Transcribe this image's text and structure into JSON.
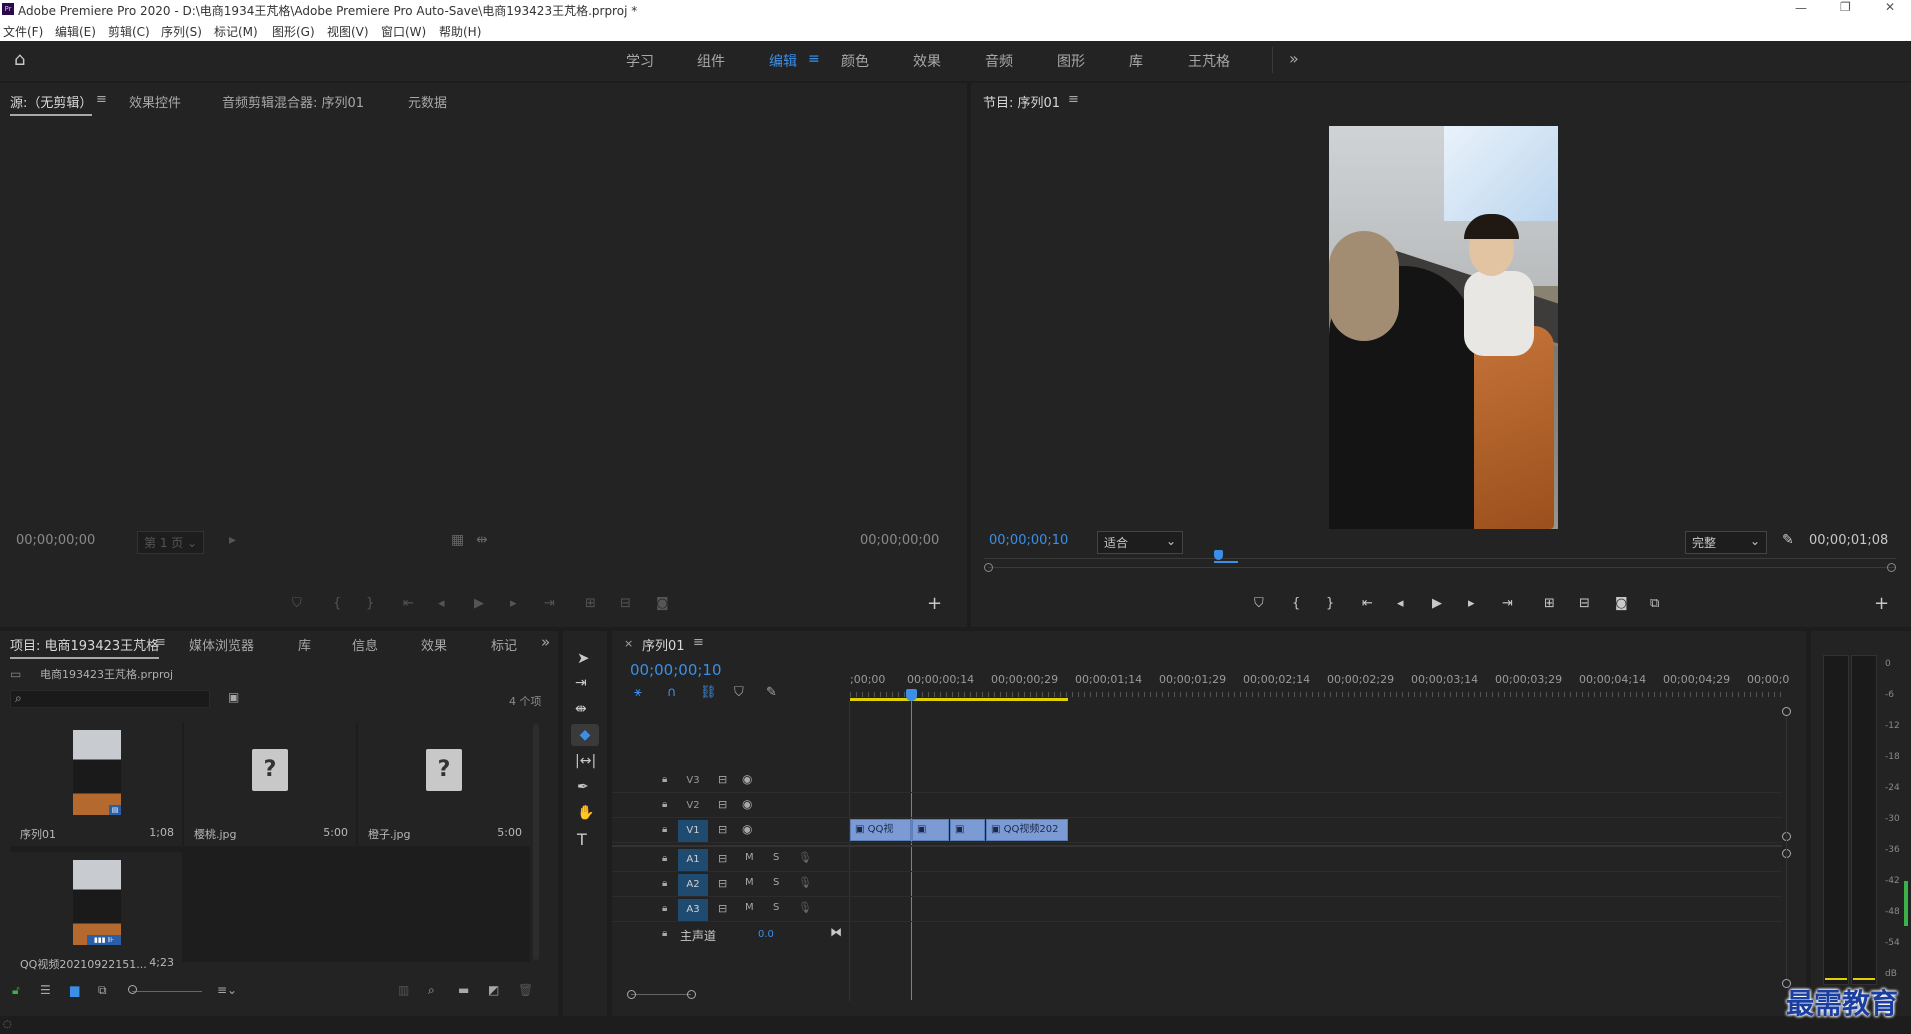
{
  "title": "Adobe Premiere Pro 2020 - D:\\电商1934王芃格\\Adobe Premiere Pro Auto-Save\\电商193423王芃格.prproj *",
  "menu": [
    "文件(F)",
    "编辑(E)",
    "剪辑(C)",
    "序列(S)",
    "标记(M)",
    "图形(G)",
    "视图(V)",
    "窗口(W)",
    "帮助(H)"
  ],
  "workspaces": [
    "学习",
    "组件",
    "编辑",
    "颜色",
    "效果",
    "音频",
    "图形",
    "库",
    "王芃格"
  ],
  "active_workspace": "编辑",
  "colors": {
    "accent": "#3b8fe8",
    "clip": "#7c9bd4",
    "panel": "#232323",
    "bg": "#1d1d1d"
  },
  "source": {
    "tabs": [
      "源:（无剪辑）",
      "效果控件",
      "音频剪辑混合器: 序列01",
      "元数据"
    ],
    "tc_left": "00;00;00;00",
    "page": "第 1 页",
    "tc_right": "00;00;00;00"
  },
  "program": {
    "tab": "节目: 序列01",
    "tc_left": "00;00;00;10",
    "fit": "适合",
    "quality": "完整",
    "tc_right": "00;00;01;08"
  },
  "project": {
    "tabs": [
      "项目: 电商193423王芃格",
      "媒体浏览器",
      "库",
      "信息",
      "效果",
      "标记"
    ],
    "file": "电商193423王芃格.prproj",
    "count": "4 个项",
    "items": [
      {
        "name": "序列01",
        "duration": "1;08",
        "kind": "video"
      },
      {
        "name": "樱桃.jpg",
        "duration": "5:00",
        "kind": "missing"
      },
      {
        "name": "橙子.jpg",
        "duration": "5:00",
        "kind": "missing"
      },
      {
        "name": "QQ视频20210922151...",
        "duration": "4;23",
        "kind": "video"
      }
    ]
  },
  "timeline": {
    "tab": "序列01",
    "tc": "00;00;00;10",
    "ruler": [
      ";00;00",
      "00;00;00;14",
      "00;00;00;29",
      "00;00;01;14",
      "00;00;01;29",
      "00;00;02;14",
      "00;00;02;29",
      "00;00;03;14",
      "00;00;03;29",
      "00;00;04;14",
      "00;00;04;29",
      "00;00;0"
    ],
    "video_tracks": [
      "V3",
      "V2",
      "V1"
    ],
    "audio_tracks": [
      "A1",
      "A2",
      "A3"
    ],
    "master": "主声道",
    "master_val": "0.0",
    "clips": [
      "QQ视",
      "QQ视频202"
    ]
  },
  "meter_scale": [
    "0",
    "-6",
    "-12",
    "-18",
    "-24",
    "-30",
    "-36",
    "-42",
    "-48",
    "-54",
    "dB"
  ],
  "watermark": "最需教育"
}
